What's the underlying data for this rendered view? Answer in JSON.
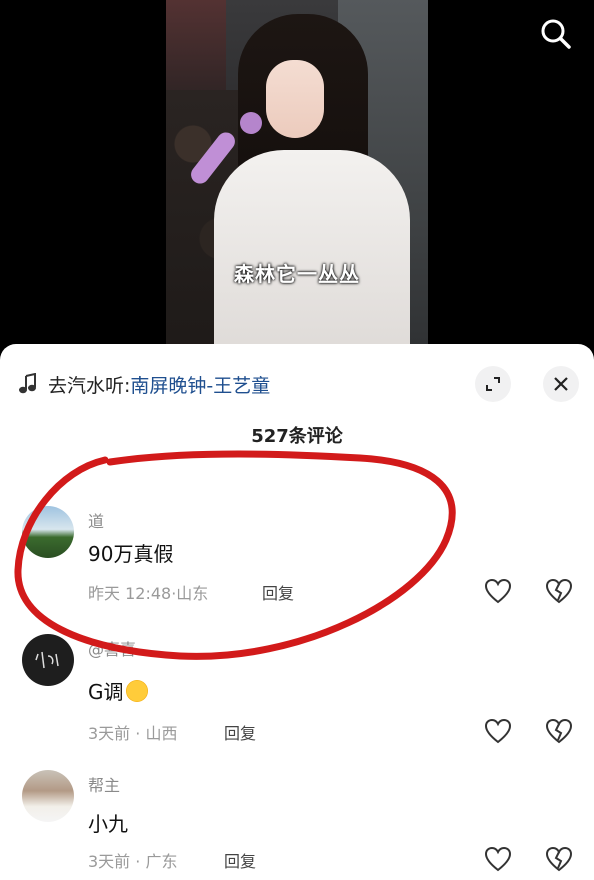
{
  "video": {
    "subtitle": "森林它一丛丛"
  },
  "top_bar": {
    "search_icon": "search-icon"
  },
  "sheet": {
    "music": {
      "prefix": "去汽水听:",
      "song": "南屏晚钟-王艺童",
      "icon": "music-note-icon"
    },
    "collapse_icon": "collapse-icon",
    "close_icon": "close-icon",
    "comment_count": "527条评论"
  },
  "comments": [
    {
      "user": "道",
      "text": "90万真假",
      "time": "昨天 12:48",
      "location": "山东",
      "reply_label": "回复"
    },
    {
      "user": "@喜喜",
      "text": "G调",
      "time": "3天前",
      "location": "山西",
      "reply_label": "回复",
      "emoji": "laughing-crying-emoji"
    },
    {
      "user": "帮主",
      "text": "小九",
      "time": "3天前",
      "location": "广东",
      "reply_label": "回复"
    }
  ],
  "colors": {
    "annotation_red": "#d21a1a",
    "link_blue": "#1f4f8f"
  }
}
